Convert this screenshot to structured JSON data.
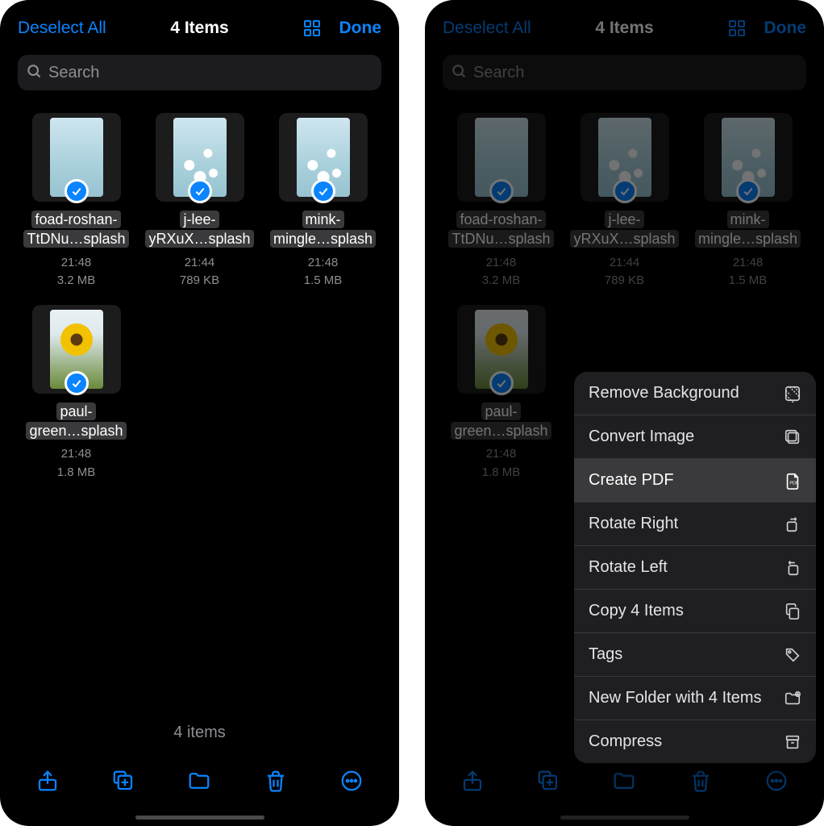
{
  "left": {
    "header": {
      "deselect": "Deselect All",
      "title": "4 Items",
      "done": "Done"
    },
    "search": {
      "placeholder": "Search"
    },
    "files": [
      {
        "name_line1": "foad-roshan-",
        "name_line2": "TtDNu…splash",
        "time": "21:48",
        "size": "3.2 MB",
        "thumb": "plain"
      },
      {
        "name_line1": "j-lee-",
        "name_line2": "yRXuX…splash",
        "time": "21:44",
        "size": "789 KB",
        "thumb": "flowers"
      },
      {
        "name_line1": "mink-",
        "name_line2": "mingle…splash",
        "time": "21:48",
        "size": "1.5 MB",
        "thumb": "flowers"
      },
      {
        "name_line1": "paul-",
        "name_line2": "green…splash",
        "time": "21:48",
        "size": "1.8 MB",
        "thumb": "sunflower"
      }
    ],
    "footer_count": "4 items"
  },
  "right": {
    "header": {
      "deselect": "Deselect All",
      "title": "4 Items",
      "done": "Done"
    },
    "search": {
      "placeholder": "Search"
    },
    "files": [
      {
        "name_line1": "foad-roshan-",
        "name_line2": "TtDNu…splash",
        "time": "21:48",
        "size": "3.2 MB",
        "thumb": "plain"
      },
      {
        "name_line1": "j-lee-",
        "name_line2": "yRXuX…splash",
        "time": "21:44",
        "size": "789 KB",
        "thumb": "flowers"
      },
      {
        "name_line1": "mink-",
        "name_line2": "mingle…splash",
        "time": "21:48",
        "size": "1.5 MB",
        "thumb": "flowers"
      },
      {
        "name_line1": "paul-",
        "name_line2": "green…splash",
        "time": "21:48",
        "size": "1.8 MB",
        "thumb": "sunflower"
      }
    ],
    "context_menu": [
      {
        "label": "Remove Background",
        "icon": "remove-bg-icon",
        "highlight": false
      },
      {
        "label": "Convert Image",
        "icon": "convert-icon",
        "highlight": false
      },
      {
        "label": "Create PDF",
        "icon": "pdf-icon",
        "highlight": true
      },
      {
        "label": "Rotate Right",
        "icon": "rotate-right-icon",
        "highlight": false
      },
      {
        "label": "Rotate Left",
        "icon": "rotate-left-icon",
        "highlight": false
      },
      {
        "label": "Copy 4 Items",
        "icon": "copy-icon",
        "highlight": false
      },
      {
        "label": "Tags",
        "icon": "tag-icon",
        "highlight": false
      },
      {
        "label": "New Folder with 4 Items",
        "icon": "new-folder-icon",
        "highlight": false
      },
      {
        "label": "Compress",
        "icon": "archive-icon",
        "highlight": false
      }
    ]
  }
}
